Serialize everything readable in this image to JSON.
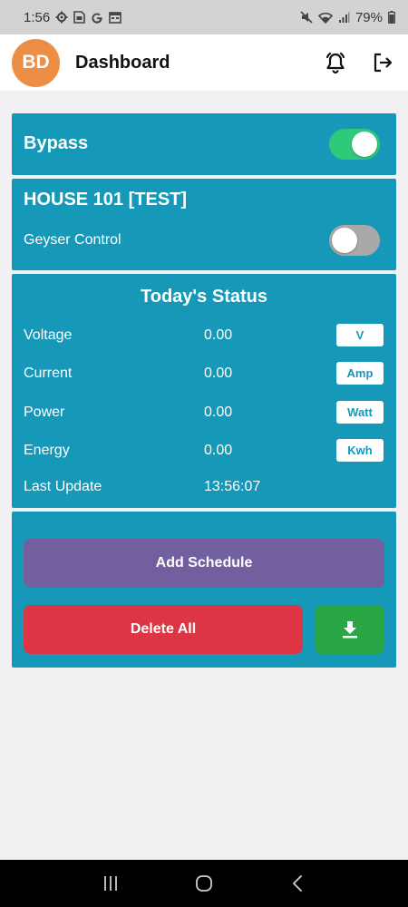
{
  "status_bar": {
    "time": "1:56",
    "battery": "79%",
    "left_icons": [
      "settings-icon",
      "sim-toolkit-icon",
      "google-icon",
      "calendar-icon"
    ],
    "right_icons": [
      "mute-icon",
      "wifi-icon",
      "signal-icon",
      "battery-icon"
    ]
  },
  "app_bar": {
    "avatar_initials": "BD",
    "title": "Dashboard",
    "avatar_color": "#ec8e46"
  },
  "bypass": {
    "label": "Bypass",
    "enabled": true
  },
  "house": {
    "title": "HOUSE 101 [TEST]",
    "geyser_label": "Geyser Control",
    "geyser_enabled": false
  },
  "status": {
    "title": "Today's Status",
    "rows": [
      {
        "label": "Voltage",
        "value": "0.00",
        "unit": "V"
      },
      {
        "label": "Current",
        "value": "0.00",
        "unit": "Amp"
      },
      {
        "label": "Power",
        "value": "0.00",
        "unit": "Watt"
      },
      {
        "label": "Energy",
        "value": "0.00",
        "unit": "Kwh"
      }
    ],
    "last_update_label": "Last Update",
    "last_update_value": "13:56:07"
  },
  "actions": {
    "add_schedule": "Add Schedule",
    "delete_all": "Delete All"
  },
  "colors": {
    "card": "#1698b9",
    "toggle_on": "#2fc97a",
    "toggle_off": "#a9a9a9",
    "schedule": "#725f9f",
    "delete": "#de3545",
    "download": "#28a744"
  }
}
